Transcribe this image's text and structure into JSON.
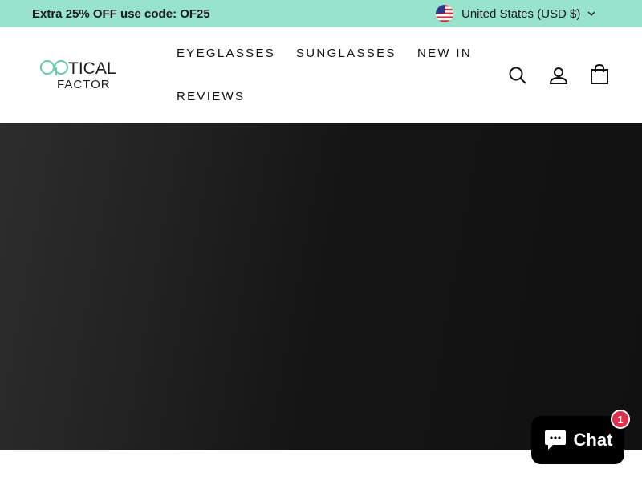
{
  "announcement": {
    "promo_text": "Extra 25% OFF use code: OF25",
    "locale_label": "United States (USD $)",
    "flag_icon": "us-flag-icon",
    "chevron_icon": "chevron-down-icon"
  },
  "brand": {
    "line1": "TICAL",
    "line2": "FACTOR",
    "accent_color": "#5fcfae"
  },
  "nav": {
    "items": [
      "EYEGLASSES",
      "SUNGLASSES",
      "NEW IN",
      "REVIEWS"
    ]
  },
  "header_icons": [
    "search-icon",
    "account-icon",
    "cart-icon"
  ],
  "chat": {
    "label": "Chat",
    "badge_count": "1",
    "icon": "chat-bubble-icon"
  },
  "colors": {
    "announcement_bg": "#98e3cb",
    "hero_bg": "#181818",
    "chat_badge": "#e0314c"
  }
}
